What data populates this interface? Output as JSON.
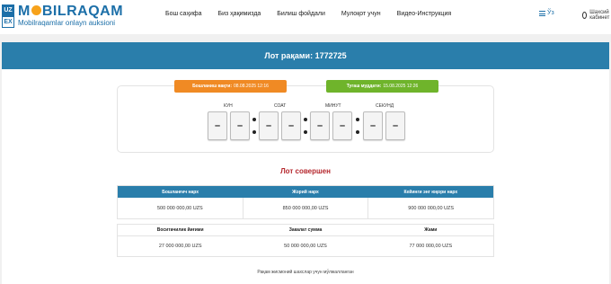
{
  "logo": {
    "box_top": "UZ",
    "box_bottom": "EX",
    "title_a": "M",
    "title_b": "BILRAQAM",
    "subtitle": "Mobilraqamlar onlayn auksioni"
  },
  "nav": [
    {
      "label": "Бош саҳифа"
    },
    {
      "label": "Биз ҳақимизда"
    },
    {
      "label": "Билиш фойдали"
    },
    {
      "label": "Мулоқот учун"
    },
    {
      "label": "Видео-Инструкция"
    }
  ],
  "lang": {
    "label": "Ўз"
  },
  "cabinet": {
    "label": "Шахсий кабинет"
  },
  "lot": {
    "title": "Лот рақами: 1772725"
  },
  "timer": {
    "start_label": "Бошланиш вақти:",
    "start_value": "08.08.2025 12:16",
    "end_label": "Тугаш муддати:",
    "end_value": "15.08.2025 12:26",
    "labels": {
      "day": "КУН",
      "hour": "СОАТ",
      "minute": "МИНУТ",
      "second": "СЕКУНД"
    },
    "digits": [
      "–",
      "–",
      "–",
      "–",
      "–",
      "–",
      "–",
      "–"
    ]
  },
  "status": "Лот совершен",
  "prices": {
    "headers": [
      "Бошланғич нарх",
      "Жорий нарх",
      "Кейинги энг юқори нарх"
    ],
    "values": [
      "500 000 000,00 UZS",
      "850 000 000,00 UZS",
      "900 000 000,00 UZS"
    ]
  },
  "fees": {
    "headers": [
      "Воситачилик йиғими",
      "Закалат сумма",
      "Жами"
    ],
    "values": [
      "27 000 000,00 UZS",
      "50 000 000,00 UZS",
      "77 000 000,00 UZS"
    ]
  },
  "note": "Рақам жисмоний шахслар учун мўлжалланган",
  "colors": {
    "accent": "#2a7eab",
    "orange": "#f08a24",
    "green": "#6fb42b",
    "red": "#b5272d"
  }
}
